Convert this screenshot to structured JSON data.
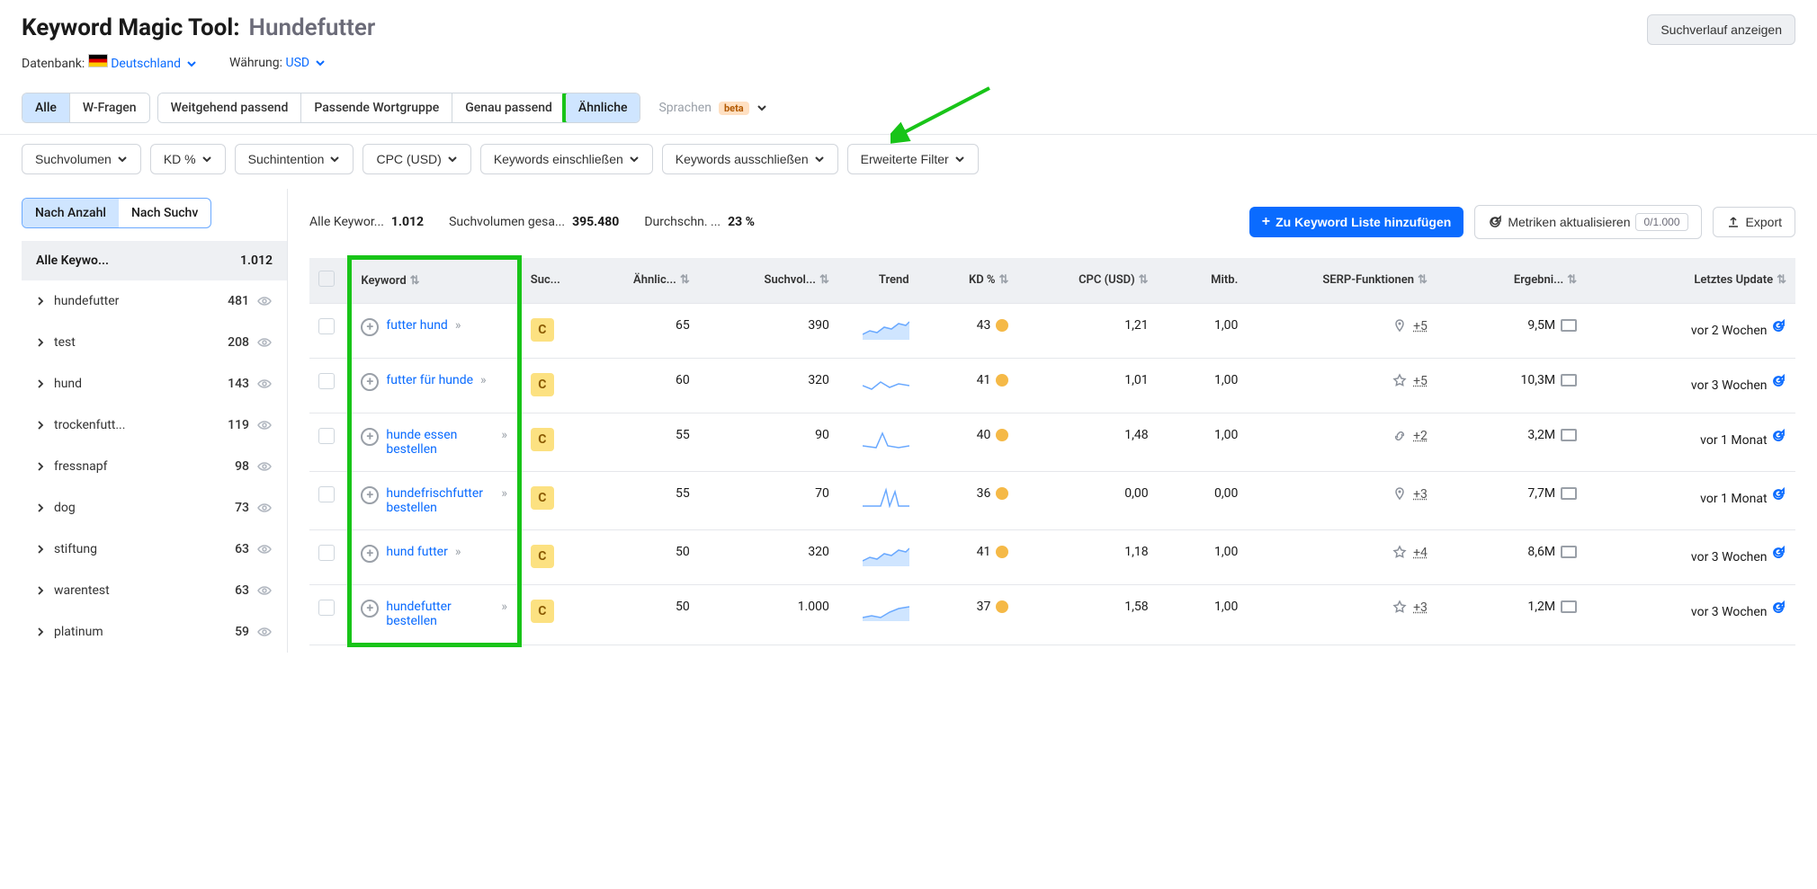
{
  "header": {
    "tool_name": "Keyword Magic Tool:",
    "query": "Hundefutter",
    "history_btn": "Suchverlauf anzeigen",
    "db_label": "Datenbank:",
    "db_value": "Deutschland",
    "currency_label": "Währung:",
    "currency_value": "USD"
  },
  "match_tabs": {
    "all": "Alle",
    "questions": "W-Fragen",
    "broad": "Weitgehend passend",
    "phrase": "Passende Wortgruppe",
    "exact": "Genau passend",
    "related": "Ähnliche",
    "languages": "Sprachen",
    "beta": "beta"
  },
  "filters": {
    "volume": "Suchvolumen",
    "kd": "KD %",
    "intent": "Suchintention",
    "cpc": "CPC (USD)",
    "include": "Keywords einschließen",
    "exclude": "Keywords ausschließen",
    "advanced": "Erweiterte Filter"
  },
  "sidebar": {
    "by_count": "Nach Anzahl",
    "by_volume": "Nach Suchv",
    "all_label": "Alle Keywo...",
    "all_count": "1.012",
    "groups": [
      {
        "name": "hundefutter",
        "count": "481"
      },
      {
        "name": "test",
        "count": "208"
      },
      {
        "name": "hund",
        "count": "143"
      },
      {
        "name": "trockenfutt...",
        "count": "119"
      },
      {
        "name": "fressnapf",
        "count": "98"
      },
      {
        "name": "dog",
        "count": "73"
      },
      {
        "name": "stiftung",
        "count": "63"
      },
      {
        "name": "warentest",
        "count": "63"
      },
      {
        "name": "platinum",
        "count": "59"
      }
    ]
  },
  "summary": {
    "all_lbl": "Alle Keywor...",
    "all_val": "1.012",
    "vol_lbl": "Suchvolumen gesa...",
    "vol_val": "395.480",
    "avg_lbl": "Durchschn. ...",
    "avg_val": "23 %",
    "add_btn": "Zu Keyword Liste hinzufügen",
    "refresh_btn": "Metriken aktualisieren",
    "refresh_count": "0/1.000",
    "export_btn": "Export"
  },
  "columns": {
    "keyword": "Keyword",
    "intent": "Suc...",
    "similar": "Ähnlic...",
    "volume": "Suchvol...",
    "trend": "Trend",
    "kd": "KD %",
    "cpc": "CPC (USD)",
    "comp": "Mitb.",
    "serp": "SERP-Funktionen",
    "results": "Ergebni...",
    "updated": "Letztes Update"
  },
  "rows": [
    {
      "keyword": "futter hund",
      "intent": "C",
      "similar": "65",
      "volume": "390",
      "kd": "43",
      "kd_color": "#f5b947",
      "cpc": "1,21",
      "comp": "1,00",
      "serp_icon": "pin",
      "serp_n": "+5",
      "results": "9,5M",
      "updated": "vor 2 Wochen",
      "trend": "area"
    },
    {
      "keyword": "futter für hunde",
      "intent": "C",
      "similar": "60",
      "volume": "320",
      "kd": "41",
      "kd_color": "#f5b947",
      "cpc": "1,01",
      "comp": "1,00",
      "serp_icon": "star",
      "serp_n": "+5",
      "results": "10,3M",
      "updated": "vor 3 Wochen",
      "trend": "line"
    },
    {
      "keyword": "hunde essen bestellen",
      "intent": "C",
      "similar": "55",
      "volume": "90",
      "kd": "40",
      "kd_color": "#f5b947",
      "cpc": "1,48",
      "comp": "1,00",
      "serp_icon": "link",
      "serp_n": "+2",
      "results": "3,2M",
      "updated": "vor 1 Monat",
      "trend": "spike"
    },
    {
      "keyword": "hundefrischfutter bestellen",
      "intent": "C",
      "similar": "55",
      "volume": "70",
      "kd": "36",
      "kd_color": "#f5b947",
      "cpc": "0,00",
      "comp": "0,00",
      "serp_icon": "pin",
      "serp_n": "+3",
      "results": "7,7M",
      "updated": "vor 1 Monat",
      "trend": "spike2"
    },
    {
      "keyword": "hund futter",
      "intent": "C",
      "similar": "50",
      "volume": "320",
      "kd": "41",
      "kd_color": "#f5b947",
      "cpc": "1,18",
      "comp": "1,00",
      "serp_icon": "star",
      "serp_n": "+4",
      "results": "8,6M",
      "updated": "vor 3 Wochen",
      "trend": "area"
    },
    {
      "keyword": "hundefutter bestellen",
      "intent": "C",
      "similar": "50",
      "volume": "1.000",
      "kd": "37",
      "kd_color": "#f5b947",
      "cpc": "1,58",
      "comp": "1,00",
      "serp_icon": "star",
      "serp_n": "+3",
      "results": "1,2M",
      "updated": "vor 3 Wochen",
      "trend": "area2"
    }
  ]
}
